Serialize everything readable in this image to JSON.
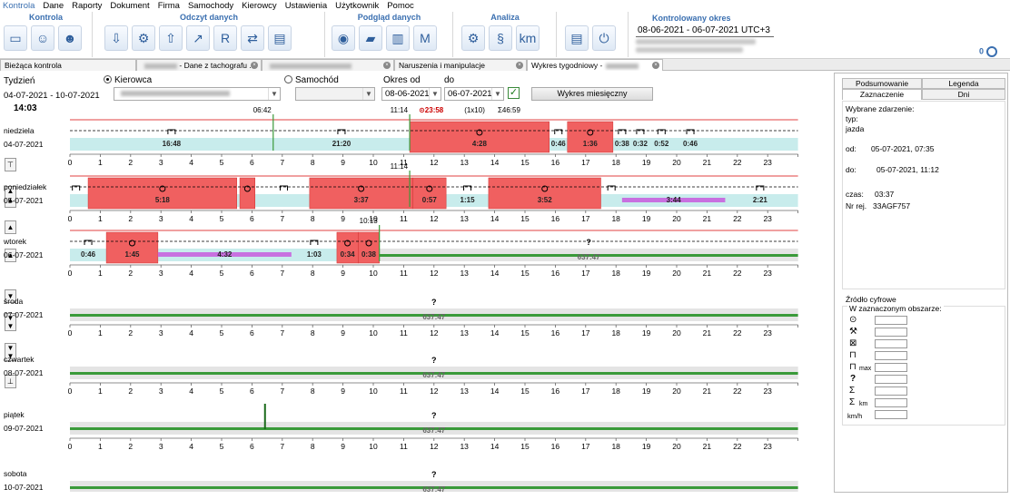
{
  "menu": [
    "Kontrola",
    "Dane",
    "Raporty",
    "Dokument",
    "Firma",
    "Samochody",
    "Kierowcy",
    "Ustawienia",
    "Użytkownik",
    "Pomoc"
  ],
  "ribbon": {
    "groups": [
      {
        "title": "Kontrola",
        "icons": [
          "card-reader-icon",
          "driver-card-icon",
          "company-card-icon"
        ]
      },
      {
        "title": "Odczyt danych",
        "icons": [
          "download-icon",
          "tachograph-icon",
          "upload-icon",
          "export-icon",
          "report-icon",
          "transfer-icon",
          "card-copy-icon"
        ]
      },
      {
        "title": "Podgląd danych",
        "icons": [
          "disc-icon",
          "vehicle-icon",
          "week-chart-icon",
          "month-chart-icon"
        ]
      },
      {
        "title": "Analiza",
        "icons": [
          "analysis-icon",
          "law-paragraph-icon",
          "distance-km-icon"
        ]
      },
      {
        "title": "",
        "icons": [
          "print-icon",
          "power-icon"
        ]
      }
    ],
    "kontrolowany_title": "Kontrolowany okres",
    "kontrolowany_range": "08-06-2021 - 06-07-2021 UTC+3",
    "corner_value": "0"
  },
  "tabs": [
    {
      "label": "Bieżąca kontrola",
      "closable": false,
      "active": false
    },
    {
      "label": "- Dane z tachografu ...",
      "closable": true,
      "active": false
    },
    {
      "label": "",
      "closable": true,
      "active": false
    },
    {
      "label": "Naruszenia i manipulacje",
      "closable": true,
      "active": false
    },
    {
      "label": "Wykres tygodniowy -",
      "closable": true,
      "active": true
    }
  ],
  "controls": {
    "week_label": "Tydzień",
    "week_range": "04-07-2021 - 10-07-2021",
    "current_time": "14:03",
    "driver_radio": "Kierowca",
    "vehicle_radio": "Samochód",
    "period_from_label": "Okres od",
    "period_to_label": "do",
    "period_from": "08-06-2021",
    "period_to": "06-07-2021",
    "monthly_button": "Wykres miesięczny"
  },
  "axis_hours": [
    "0",
    "1",
    "2",
    "3",
    "4",
    "5",
    "6",
    "7",
    "8",
    "9",
    "10",
    "11",
    "12",
    "13",
    "14",
    "15",
    "16",
    "17",
    "18",
    "19",
    "20",
    "21",
    "22",
    "23"
  ],
  "days": [
    {
      "name": "niedziela",
      "date": "04-07-2021",
      "segments": [
        {
          "type": "rest",
          "start": 0,
          "end": 6.7,
          "label": "16:48"
        },
        {
          "type": "rest",
          "start": 6.7,
          "end": 11.2,
          "label": "21:20"
        },
        {
          "type": "drive",
          "start": 11.2,
          "end": 15.8,
          "label": "4:28"
        },
        {
          "type": "rest",
          "start": 15.8,
          "end": 16.4,
          "label": "0:46"
        },
        {
          "type": "drive",
          "start": 16.4,
          "end": 17.9,
          "label": "1:36"
        },
        {
          "type": "rest",
          "start": 17.9,
          "end": 18.5,
          "label": "0:38"
        },
        {
          "type": "rest",
          "start": 18.5,
          "end": 19.1,
          "label": "0:32"
        },
        {
          "type": "rest",
          "start": 19.1,
          "end": 19.9,
          "label": "0:52"
        },
        {
          "type": "rest",
          "start": 19.9,
          "end": 21.0,
          "label": "0:46"
        }
      ],
      "markers": [
        {
          "at": 6.7,
          "label": "06:42"
        },
        {
          "at": 11.2,
          "label": "11:14"
        }
      ],
      "summary": {
        "time": "23:58",
        "count": "(1x10)",
        "total": "Σ46:59"
      }
    },
    {
      "name": "poniedziałek",
      "date": "05-07-2021",
      "segments": [
        {
          "type": "rest",
          "start": 0,
          "end": 0.4,
          "label": ""
        },
        {
          "type": "drive",
          "start": 0.6,
          "end": 5.5,
          "label": "5:18"
        },
        {
          "type": "drive",
          "start": 5.6,
          "end": 6.1,
          "label": ""
        },
        {
          "type": "rest",
          "start": 6.2,
          "end": 7.9,
          "label": ""
        },
        {
          "type": "drive",
          "start": 7.9,
          "end": 11.3,
          "label": "3:37"
        },
        {
          "type": "drive",
          "start": 11.3,
          "end": 12.4,
          "label": "0:57"
        },
        {
          "type": "rest",
          "start": 12.4,
          "end": 13.8,
          "label": "1:15"
        },
        {
          "type": "drive",
          "start": 13.8,
          "end": 17.5,
          "label": "3:52"
        },
        {
          "type": "rest",
          "start": 17.5,
          "end": 18.2,
          "label": ""
        },
        {
          "type": "work",
          "start": 18.2,
          "end": 21.6,
          "label": "3:44"
        },
        {
          "type": "rest",
          "start": 21.6,
          "end": 23.9,
          "label": "2:21"
        }
      ],
      "markers": [
        {
          "at": 11.2,
          "label": "11:14"
        }
      ]
    },
    {
      "name": "wtorek",
      "date": "06-07-2021",
      "segments": [
        {
          "type": "rest",
          "start": 0,
          "end": 1.2,
          "label": "0:46"
        },
        {
          "type": "drive",
          "start": 1.2,
          "end": 2.9,
          "label": "1:45"
        },
        {
          "type": "work",
          "start": 2.9,
          "end": 7.3,
          "label": "4:32"
        },
        {
          "type": "rest",
          "start": 7.3,
          "end": 8.8,
          "label": "1:03"
        },
        {
          "type": "drive",
          "start": 8.8,
          "end": 9.5,
          "label": "0:34"
        },
        {
          "type": "drive",
          "start": 9.5,
          "end": 10.2,
          "label": "0:38"
        },
        {
          "type": "nodata",
          "start": 10.2,
          "end": 24,
          "label": "637:47"
        }
      ],
      "markers": [
        {
          "at": 10.2,
          "label": "10:13"
        }
      ]
    },
    {
      "name": "środa",
      "date": "07-07-2021",
      "segments": [
        {
          "type": "nodata",
          "start": 0,
          "end": 24,
          "label": "637:47"
        }
      ],
      "markers": []
    },
    {
      "name": "czwartek",
      "date": "08-07-2021",
      "segments": [
        {
          "type": "nodata",
          "start": 0,
          "end": 24,
          "label": "637:47"
        }
      ],
      "markers": []
    },
    {
      "name": "piątek",
      "date": "09-07-2021",
      "segments": [
        {
          "type": "nodata",
          "start": 0,
          "end": 24,
          "label": "637:47"
        }
      ],
      "markers": []
    },
    {
      "name": "sobota",
      "date": "10-07-2021",
      "segments": [
        {
          "type": "nodata",
          "start": 0,
          "end": 24,
          "label": "637:47"
        }
      ],
      "markers": []
    }
  ],
  "right_panel": {
    "tabs": [
      "Podsumowanie",
      "Legenda",
      "Zaznaczenie",
      "Dni"
    ],
    "selected_event_title": "Wybrane zdarzenie:",
    "type_label": "typ:",
    "type_value": "jazda",
    "from_label": "od:",
    "from_value": "05-07-2021, 07:35",
    "to_label": "do:",
    "to_value": "05-07-2021, 11:12",
    "time_label": "czas:",
    "time_value": "03:37",
    "reg_label": "Nr rej.",
    "reg_value": "33AGF757",
    "digital_source": "Źródło cyfrowe",
    "area_title": "W zaznaczonym obszarze:",
    "max_label": "max",
    "km_label": "km",
    "kmh_label": "km/h"
  },
  "colors": {
    "drive": "#f06060",
    "work": "#c870e0",
    "rest_band": "#c8ecec",
    "nodata_band": "#e4e4e4",
    "green_line": "#3a9a3a",
    "accent_blue": "#3a6fb0"
  }
}
